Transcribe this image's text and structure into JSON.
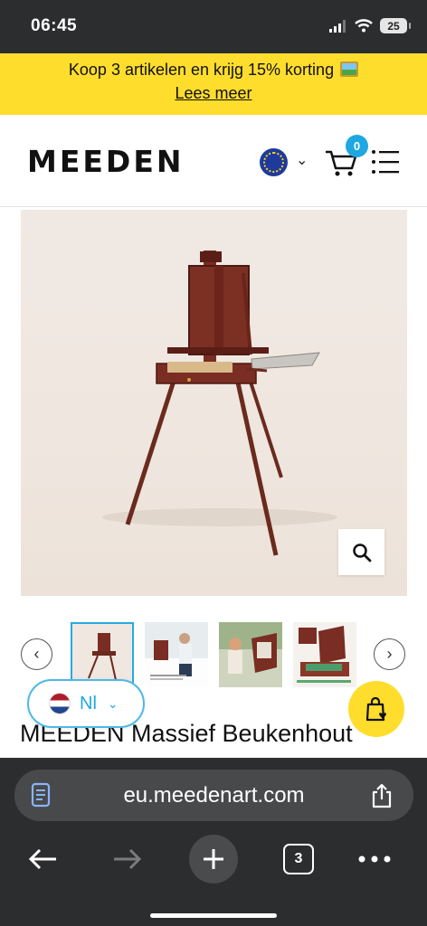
{
  "status_bar": {
    "time": "06:45",
    "battery": "25"
  },
  "promo": {
    "text": "Koop 3 artikelen en krijg 15% korting",
    "link": "Lees meer",
    "emoji": "framed-picture"
  },
  "header": {
    "logo": "MEEDEN",
    "cart_count": "0",
    "region": "eu-flag"
  },
  "gallery": {
    "thumbnail_count": 4,
    "active_index": 0
  },
  "language": {
    "code": "Nl"
  },
  "product": {
    "title": "MEEDEN Massief Beukenhout"
  },
  "browser": {
    "url": "eu.meedenart.com",
    "tab_count": "3"
  },
  "colors": {
    "accent": "#1ea7e1",
    "promo": "#ffdd2d",
    "chrome": "#2c2d2f"
  }
}
